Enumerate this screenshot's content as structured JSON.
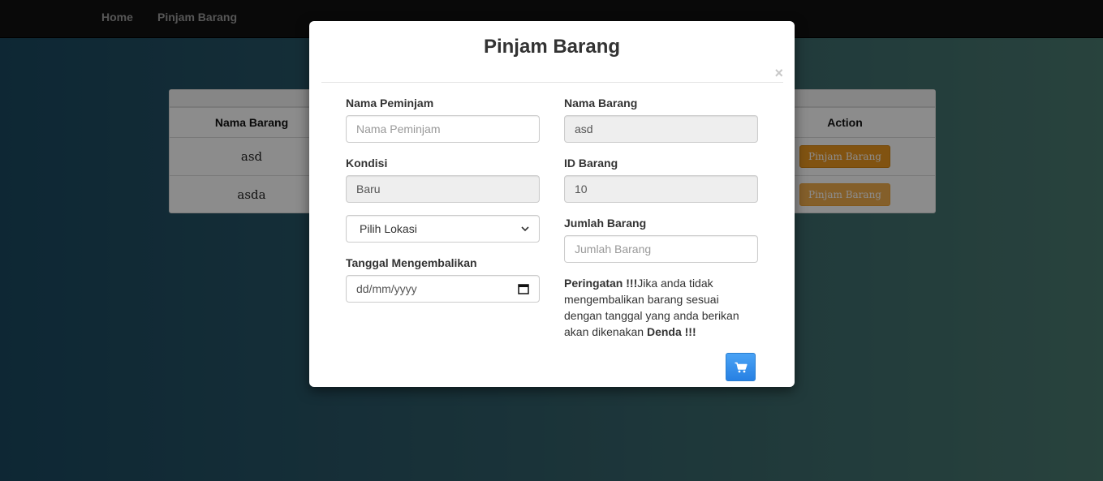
{
  "navbar": {
    "home": "Home",
    "pinjam": "Pinjam Barang"
  },
  "table": {
    "headers": {
      "nama": "Nama Barang",
      "action": "Action"
    },
    "rows": [
      {
        "nama": "asd",
        "action": "Pinjam Barang"
      },
      {
        "nama": "asda",
        "action": "Pinjam Barang"
      }
    ]
  },
  "modal": {
    "title": "Pinjam Barang",
    "close": "×",
    "nama_peminjam": {
      "label": "Nama Peminjam",
      "placeholder": "Nama Peminjam"
    },
    "nama_barang": {
      "label": "Nama Barang",
      "value": "asd"
    },
    "kondisi": {
      "label": "Kondisi",
      "value": "Baru"
    },
    "id_barang": {
      "label": "ID Barang",
      "value": "10"
    },
    "lokasi": {
      "value": "Pilih Lokasi"
    },
    "jumlah": {
      "label": "Jumlah Barang",
      "placeholder": "Jumlah Barang"
    },
    "tanggal": {
      "label": "Tanggal Mengembalikan",
      "placeholder": "dd/mm/yyyy"
    },
    "warning": {
      "prefix": "Peringatan !!!",
      "text": "Jika anda tidak mengembalikan barang sesuai dengan tanggal yang anda berikan akan dikenakan ",
      "suffix": "Denda !!!"
    },
    "submit_icon": "cart-icon"
  },
  "colors": {
    "navbar": "#111111",
    "action_button": "#f0ad4e",
    "submit_button": "#2780e3"
  }
}
